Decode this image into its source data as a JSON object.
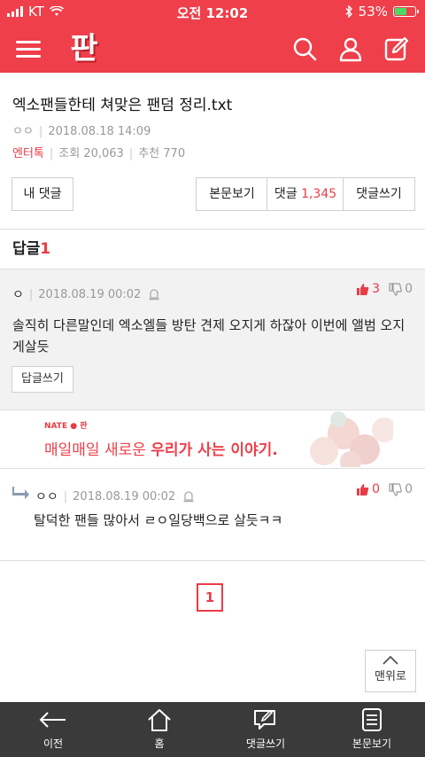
{
  "status": {
    "carrier": "KT",
    "time": "오전 12:02",
    "battery": "53%",
    "battery_level": 0.53
  },
  "appbar": {
    "logo": "판"
  },
  "post": {
    "title": "엑소팬들한테 쳐맞은 팬덤 정리.txt",
    "author": "ㅇㅇ",
    "date": "2018.08.18 14:09",
    "category": "엔터톡",
    "views": "조회 20,063",
    "recommend": "추천 770"
  },
  "buttons": {
    "my_comments": "내 댓글",
    "view_body": "본문보기",
    "comments_label": "댓글",
    "comments_count": "1,345",
    "write_comment": "댓글쓰기"
  },
  "replies": {
    "label": "답글",
    "count": "1"
  },
  "comment": {
    "author": "ㅇ",
    "date": "2018.08.19 00:02",
    "up": "3",
    "down": "0",
    "body": "솔직히 다른말인데 엑소엘들 방탄 견제 오지게 하잖아 이번에 앨범 오지게살듯",
    "reply_button": "답글쓰기"
  },
  "ad": {
    "brand": "NATE ● 판",
    "slogan_a": "매일매일 새로운",
    "slogan_b": "우리가 사는 이야기."
  },
  "reply": {
    "author": "ㅇㅇ",
    "date": "2018.08.19 00:02",
    "up": "0",
    "down": "0",
    "body": "탈덕한 팬들 많아서 ㄹㅇ일당백으로 살듯ㅋㅋ"
  },
  "pager": {
    "current": "1"
  },
  "totop": {
    "label": "맨위로"
  },
  "bottom": {
    "prev": "이전",
    "home": "홈",
    "write": "댓글쓰기",
    "body": "본문보기"
  },
  "colors": {
    "brand": "#ee3f4a",
    "accent": "#e83c47"
  }
}
